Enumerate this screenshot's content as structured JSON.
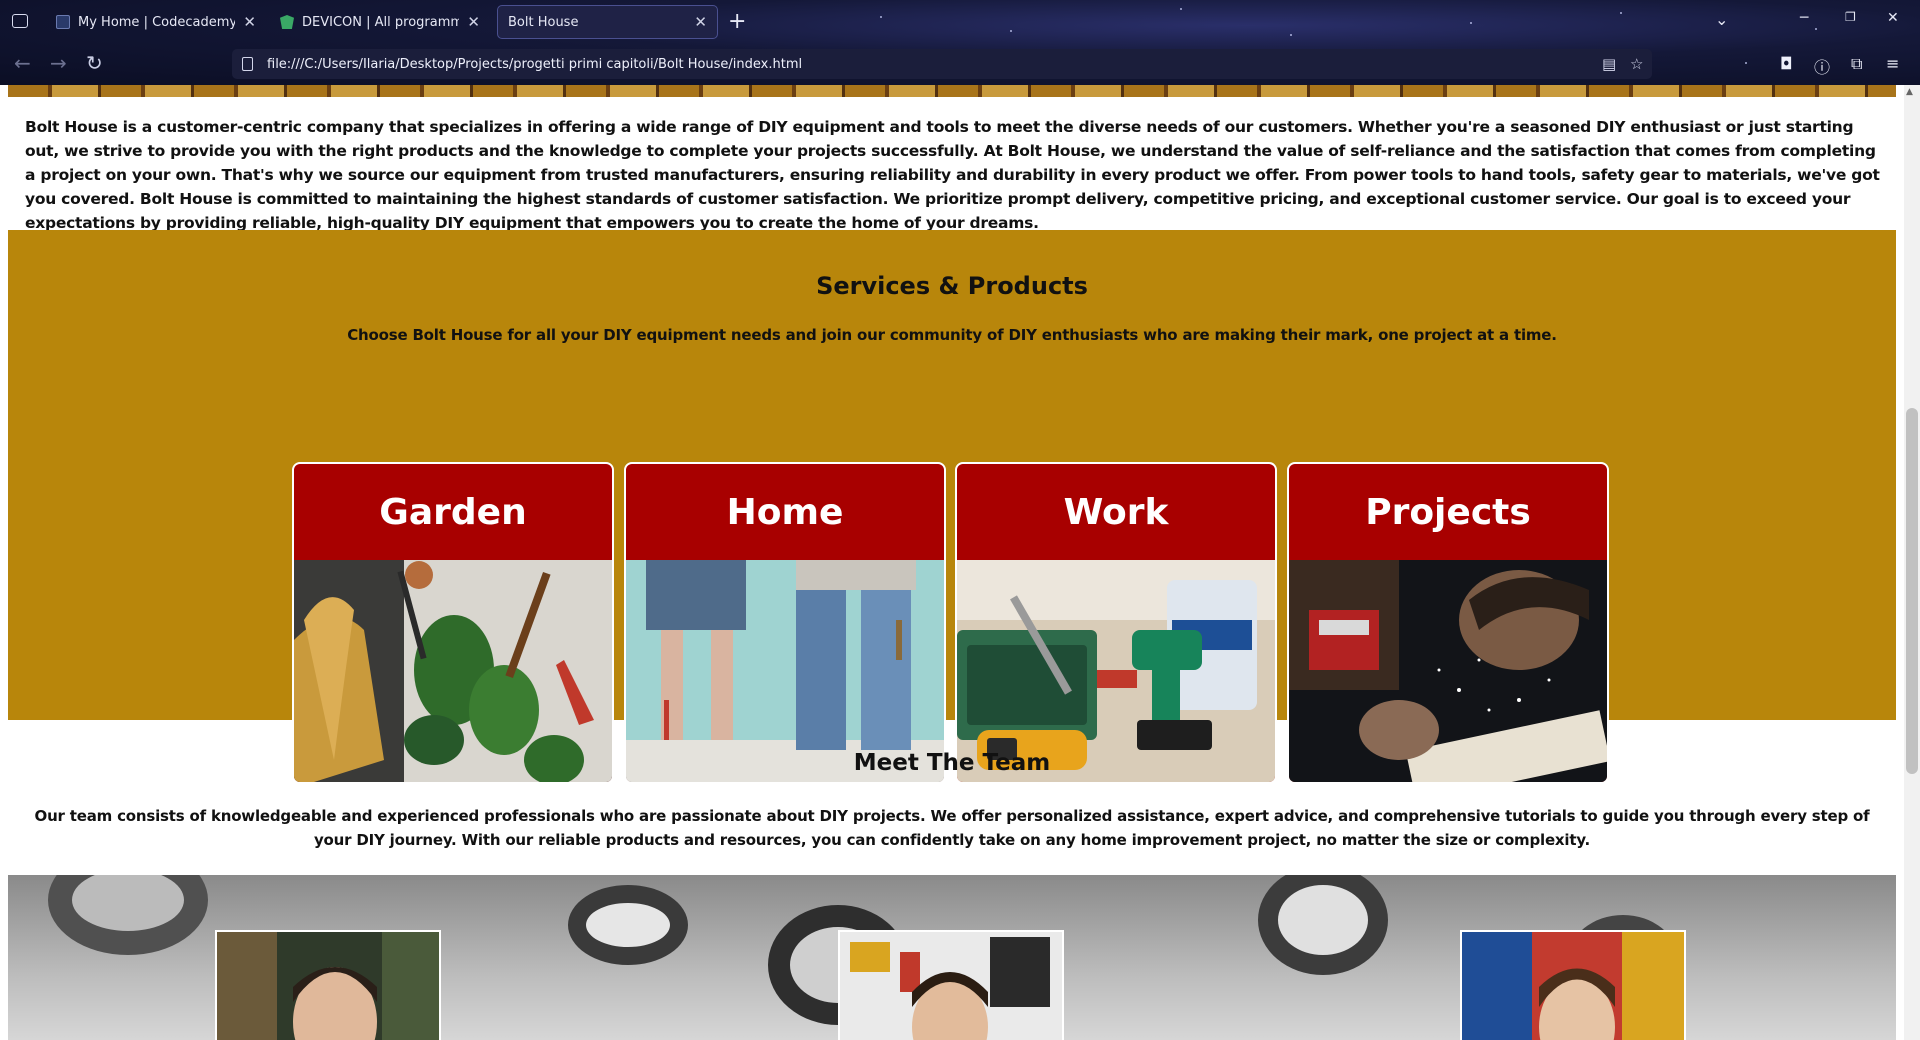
{
  "browser": {
    "tabs": [
      {
        "title": "My Home | Codecademy",
        "active": false
      },
      {
        "title": "DEVICON | All programming languages",
        "active": false
      },
      {
        "title": "Bolt House",
        "active": true
      }
    ],
    "url": "file:///C:/Users/Ilaria/Desktop/Projects/progetti primi capitoli/Bolt House/index.html"
  },
  "page": {
    "intro": "Bolt House is a customer-centric company that specializes in offering a wide range of DIY equipment and tools to meet the diverse needs of our customers. Whether you're a seasoned DIY enthusiast or just starting out, we strive to provide you with the right products and the knowledge to complete your projects successfully. At Bolt House, we understand the value of self-reliance and the satisfaction that comes from completing a project on your own. That's why we source our equipment from trusted manufacturers, ensuring reliability and durability in every product we offer. From power tools to hand tools, safety gear to materials, we've got you covered. Bolt House is committed to maintaining the highest standards of customer satisfaction. We prioritize prompt delivery, competitive pricing, and exceptional customer service. Our goal is to exceed your expectations by providing reliable, high-quality DIY equipment that empowers you to create the home of your dreams.",
    "services": {
      "title": "Services & Products",
      "subtitle": "Choose Bolt House for all your DIY equipment needs and join our community of DIY enthusiasts who are making their mark, one project at a time.",
      "cards": [
        {
          "label": "Garden"
        },
        {
          "label": "Home"
        },
        {
          "label": "Work"
        },
        {
          "label": "Projects"
        }
      ]
    },
    "team": {
      "title": "Meet The Team",
      "text": "Our team consists of knowledgeable and experienced professionals who are passionate about DIY projects. We offer personalized assistance, expert advice, and comprehensive tutorials to guide you through every step of your DIY journey. With our reliable products and resources, you can confidently take on any home improvement project, no matter the size or complexity."
    }
  },
  "colors": {
    "services_bg": "#b8860b",
    "card_header": "#a80000",
    "chrome_bg": "#141838"
  }
}
